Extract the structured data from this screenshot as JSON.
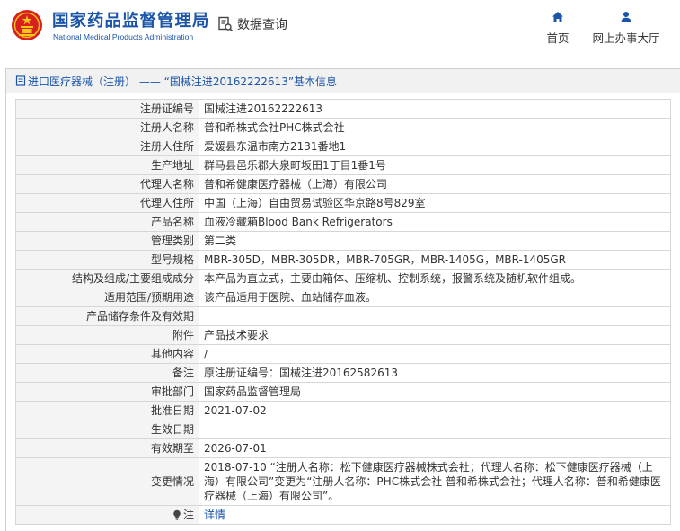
{
  "header": {
    "brand_cn": "国家药品监督管理局",
    "brand_en": "National Medical Products Administration",
    "query_label": "数据查询",
    "nav_home": "首页",
    "nav_office": "网上办事大厅",
    "accent": "#1c55a8",
    "emblem_color": "#d8211f"
  },
  "panel": {
    "title": "进口医疗器械（注册） —— “国械注进20162222613”基本信息"
  },
  "rows": [
    {
      "key": "注册证编号",
      "value": "国械注进20162222613"
    },
    {
      "key": "注册人名称",
      "value": "普和希株式会社PHC株式会社"
    },
    {
      "key": "注册人住所",
      "value": "爱媛县东温市南方2131番地1"
    },
    {
      "key": "生产地址",
      "value": "群马县邑乐郡大泉町坂田1丁目1番1号"
    },
    {
      "key": "代理人名称",
      "value": "普和希健康医疗器械（上海）有限公司"
    },
    {
      "key": "代理人住所",
      "value": "中国（上海）自由贸易试验区华京路8号829室"
    },
    {
      "key": "产品名称",
      "value": "血液冷藏箱Blood Bank Refrigerators"
    },
    {
      "key": "管理类别",
      "value": "第二类"
    },
    {
      "key": "型号规格",
      "value": "MBR-305D，MBR-305DR，MBR-705GR，MBR-1405G，MBR-1405GR"
    },
    {
      "key": "结构及组成/主要组成成分",
      "value": "本产品为直立式，主要由箱体、压缩机、控制系统，报警系统及随机软件组成。"
    },
    {
      "key": "适用范围/预期用途",
      "value": "该产品适用于医院、血站储存血液。"
    },
    {
      "key": "产品储存条件及有效期",
      "value": ""
    },
    {
      "key": "附件",
      "value": "产品技术要求"
    },
    {
      "key": "其他内容",
      "value": "/"
    },
    {
      "key": "备注",
      "value": "原注册证编号：国械注进20162582613"
    },
    {
      "key": "审批部门",
      "value": "国家药品监督管理局"
    },
    {
      "key": "批准日期",
      "value": "2021-07-02"
    },
    {
      "key": "生效日期",
      "value": ""
    },
    {
      "key": "有效期至",
      "value": "2026-07-01"
    },
    {
      "key": "变更情况",
      "value": "2018-07-10 “注册人名称：松下健康医疗器械株式会社；代理人名称：松下健康医疗器械（上海）有限公司”变更为“注册人名称：PHC株式会社 普和希株式会社；代理人名称：普和希健康医疗器械（上海）有限公司”。"
    },
    {
      "key": "注",
      "value": "详情"
    }
  ]
}
